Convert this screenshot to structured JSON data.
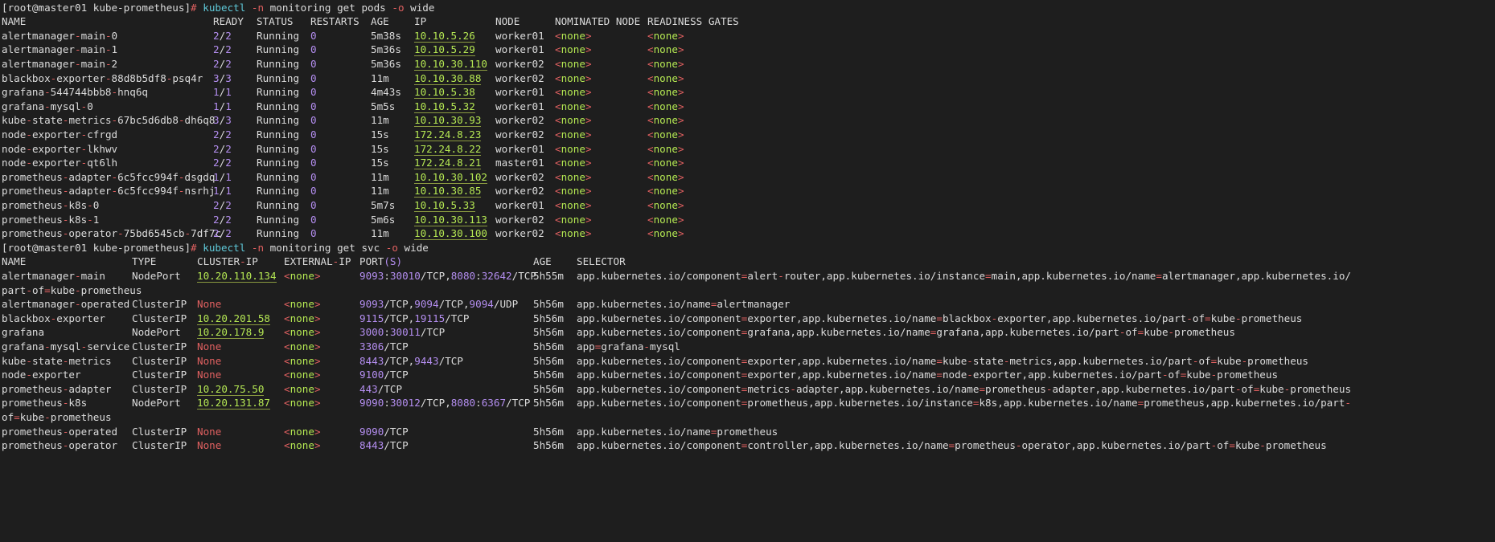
{
  "cmd1": {
    "prompt": "[root@master01 kube-prometheus]",
    "hash": "#",
    "cmd": "kubectl",
    "args": [
      "-n",
      "monitoring",
      "get",
      "pods",
      "-o",
      "wide"
    ]
  },
  "pods_header": [
    "NAME",
    "READY",
    "STATUS",
    "RESTARTS",
    "AGE",
    "IP",
    "NODE",
    "NOMINATED NODE",
    "READINESS GATES"
  ],
  "pods": [
    {
      "name": "alertmanager-main-0",
      "ready": "2/2",
      "status": "Running",
      "restarts": "0",
      "age": "5m38s",
      "ip": "10.10.5.26",
      "node": "worker01",
      "nominated": "<none>",
      "gates": "<none>"
    },
    {
      "name": "alertmanager-main-1",
      "ready": "2/2",
      "status": "Running",
      "restarts": "0",
      "age": "5m36s",
      "ip": "10.10.5.29",
      "node": "worker01",
      "nominated": "<none>",
      "gates": "<none>"
    },
    {
      "name": "alertmanager-main-2",
      "ready": "2/2",
      "status": "Running",
      "restarts": "0",
      "age": "5m36s",
      "ip": "10.10.30.110",
      "node": "worker02",
      "nominated": "<none>",
      "gates": "<none>"
    },
    {
      "name": "blackbox-exporter-88d8b5df8-psq4r",
      "ready": "3/3",
      "status": "Running",
      "restarts": "0",
      "age": "11m",
      "ip": "10.10.30.88",
      "node": "worker02",
      "nominated": "<none>",
      "gates": "<none>"
    },
    {
      "name": "grafana-544744bbb8-hnq6q",
      "ready": "1/1",
      "status": "Running",
      "restarts": "0",
      "age": "4m43s",
      "ip": "10.10.5.38",
      "node": "worker01",
      "nominated": "<none>",
      "gates": "<none>"
    },
    {
      "name": "grafana-mysql-0",
      "ready": "1/1",
      "status": "Running",
      "restarts": "0",
      "age": "5m5s",
      "ip": "10.10.5.32",
      "node": "worker01",
      "nominated": "<none>",
      "gates": "<none>"
    },
    {
      "name": "kube-state-metrics-67bc5d6db8-dh6q8",
      "ready": "3/3",
      "status": "Running",
      "restarts": "0",
      "age": "11m",
      "ip": "10.10.30.93",
      "node": "worker02",
      "nominated": "<none>",
      "gates": "<none>"
    },
    {
      "name": "node-exporter-cfrgd",
      "ready": "2/2",
      "status": "Running",
      "restarts": "0",
      "age": "15s",
      "ip": "172.24.8.23",
      "node": "worker02",
      "nominated": "<none>",
      "gates": "<none>"
    },
    {
      "name": "node-exporter-lkhwv",
      "ready": "2/2",
      "status": "Running",
      "restarts": "0",
      "age": "15s",
      "ip": "172.24.8.22",
      "node": "worker01",
      "nominated": "<none>",
      "gates": "<none>"
    },
    {
      "name": "node-exporter-qt6lh",
      "ready": "2/2",
      "status": "Running",
      "restarts": "0",
      "age": "15s",
      "ip": "172.24.8.21",
      "node": "master01",
      "nominated": "<none>",
      "gates": "<none>"
    },
    {
      "name": "prometheus-adapter-6c5fcc994f-dsgdq",
      "ready": "1/1",
      "status": "Running",
      "restarts": "0",
      "age": "11m",
      "ip": "10.10.30.102",
      "node": "worker02",
      "nominated": "<none>",
      "gates": "<none>"
    },
    {
      "name": "prometheus-adapter-6c5fcc994f-nsrhj",
      "ready": "1/1",
      "status": "Running",
      "restarts": "0",
      "age": "11m",
      "ip": "10.10.30.85",
      "node": "worker02",
      "nominated": "<none>",
      "gates": "<none>"
    },
    {
      "name": "prometheus-k8s-0",
      "ready": "2/2",
      "status": "Running",
      "restarts": "0",
      "age": "5m7s",
      "ip": "10.10.5.33",
      "node": "worker01",
      "nominated": "<none>",
      "gates": "<none>"
    },
    {
      "name": "prometheus-k8s-1",
      "ready": "2/2",
      "status": "Running",
      "restarts": "0",
      "age": "5m6s",
      "ip": "10.10.30.113",
      "node": "worker02",
      "nominated": "<none>",
      "gates": "<none>"
    },
    {
      "name": "prometheus-operator-75bd6545cb-7df7c",
      "ready": "2/2",
      "status": "Running",
      "restarts": "0",
      "age": "11m",
      "ip": "10.10.30.100",
      "node": "worker02",
      "nominated": "<none>",
      "gates": "<none>"
    }
  ],
  "cmd2": {
    "prompt": "[root@master01 kube-prometheus]",
    "hash": "#",
    "cmd": "kubectl",
    "args": [
      "-n",
      "monitoring",
      "get",
      "svc",
      "-o",
      "wide"
    ]
  },
  "svc_header": [
    "NAME",
    "TYPE",
    "CLUSTER-IP",
    "EXTERNAL-IP",
    "PORT(S)",
    "AGE",
    "SELECTOR"
  ],
  "svc": [
    {
      "name": "alertmanager-main",
      "type": "NodePort",
      "cip": "10.20.110.134",
      "eip": "<none>",
      "ports": "9093:30010/TCP,8080:32642/TCP",
      "age": "5h55m",
      "selector": "app.kubernetes.io/component=alert-router,app.kubernetes.io/instance=main,app.kubernetes.io/name=alertmanager,app.kubernetes.io/",
      "cont": "part-of=kube-prometheus"
    },
    {
      "name": "alertmanager-operated",
      "type": "ClusterIP",
      "cip": "None",
      "eip": "<none>",
      "ports": "9093/TCP,9094/TCP,9094/UDP",
      "age": "5h56m",
      "selector": "app.kubernetes.io/name=alertmanager"
    },
    {
      "name": "blackbox-exporter",
      "type": "ClusterIP",
      "cip": "10.20.201.58",
      "eip": "<none>",
      "ports": "9115/TCP,19115/TCP",
      "age": "5h56m",
      "selector": "app.kubernetes.io/component=exporter,app.kubernetes.io/name=blackbox-exporter,app.kubernetes.io/part-of=kube-prometheus"
    },
    {
      "name": "grafana",
      "type": "NodePort",
      "cip": "10.20.178.9",
      "eip": "<none>",
      "ports": "3000:30011/TCP",
      "age": "5h56m",
      "selector": "app.kubernetes.io/component=grafana,app.kubernetes.io/name=grafana,app.kubernetes.io/part-of=kube-prometheus"
    },
    {
      "name": "grafana-mysql-service",
      "type": "ClusterIP",
      "cip": "None",
      "eip": "<none>",
      "ports": "3306/TCP",
      "age": "5h56m",
      "selector": "app=grafana-mysql"
    },
    {
      "name": "kube-state-metrics",
      "type": "ClusterIP",
      "cip": "None",
      "eip": "<none>",
      "ports": "8443/TCP,9443/TCP",
      "age": "5h56m",
      "selector": "app.kubernetes.io/component=exporter,app.kubernetes.io/name=kube-state-metrics,app.kubernetes.io/part-of=kube-prometheus"
    },
    {
      "name": "node-exporter",
      "type": "ClusterIP",
      "cip": "None",
      "eip": "<none>",
      "ports": "9100/TCP",
      "age": "5h56m",
      "selector": "app.kubernetes.io/component=exporter,app.kubernetes.io/name=node-exporter,app.kubernetes.io/part-of=kube-prometheus"
    },
    {
      "name": "prometheus-adapter",
      "type": "ClusterIP",
      "cip": "10.20.75.50",
      "eip": "<none>",
      "ports": "443/TCP",
      "age": "5h56m",
      "selector": "app.kubernetes.io/component=metrics-adapter,app.kubernetes.io/name=prometheus-adapter,app.kubernetes.io/part-of=kube-prometheus"
    },
    {
      "name": "prometheus-k8s",
      "type": "NodePort",
      "cip": "10.20.131.87",
      "eip": "<none>",
      "ports": "9090:30012/TCP,8080:6367/TCP",
      "age": "5h56m",
      "selector": "app.kubernetes.io/component=prometheus,app.kubernetes.io/instance=k8s,app.kubernetes.io/name=prometheus,app.kubernetes.io/part-",
      "cont": "of=kube-prometheus"
    },
    {
      "name": "prometheus-operated",
      "type": "ClusterIP",
      "cip": "None",
      "eip": "<none>",
      "ports": "9090/TCP",
      "age": "5h56m",
      "selector": "app.kubernetes.io/name=prometheus"
    },
    {
      "name": "prometheus-operator",
      "type": "ClusterIP",
      "cip": "None",
      "eip": "<none>",
      "ports": "8443/TCP",
      "age": "5h56m",
      "selector": "app.kubernetes.io/component=controller,app.kubernetes.io/name=prometheus-operator,app.kubernetes.io/part-of=kube-prometheus"
    }
  ]
}
